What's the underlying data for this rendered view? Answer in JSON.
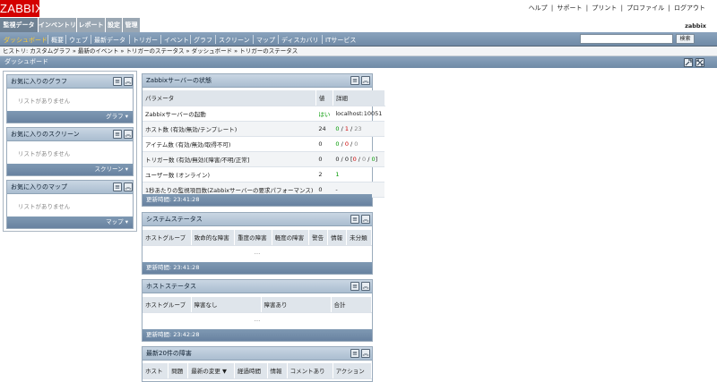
{
  "brand": {
    "logo": "ZABBIX",
    "accent": "#d40000"
  },
  "top_links": [
    "ヘルプ",
    "サポート",
    "プリント",
    "プロファイル",
    "ログアウト"
  ],
  "top_sep": "|",
  "main_menu": [
    "監視データ",
    "インベントリ",
    "レポート",
    "設定",
    "管理"
  ],
  "user": "zabbix",
  "sub_menu": [
    "ダッシュボード",
    "概要",
    "ウェブ",
    "最新データ",
    "トリガー",
    "イベント",
    "グラフ",
    "スクリーン",
    "マップ",
    "ディスカバリ",
    "ITサービス"
  ],
  "search": {
    "value": "",
    "button": "検索"
  },
  "history": "ヒストリ: カスタムグラフ » 最新のイベント » トリガーのステータス » ダッシュボード » トリガーのステータス",
  "page_title": "ダッシュボード",
  "favorites": [
    {
      "title": "お気に入りのグラフ",
      "empty": "リストがありません",
      "footer": "グラフ ▾"
    },
    {
      "title": "お気に入りのスクリーン",
      "empty": "リストがありません",
      "footer": "スクリーン ▾"
    },
    {
      "title": "お気に入りのマップ",
      "empty": "リストがありません",
      "footer": "マップ ▾"
    }
  ],
  "server_status": {
    "title": "Zabbixサーバーの状態",
    "headers": [
      "パラメータ",
      "値",
      "詳細"
    ],
    "rows": [
      {
        "param": "Zabbixサーバーの起動",
        "value": "はい",
        "detail": "localhost:10051"
      },
      {
        "param": "ホスト数 (有効/無効/テンプレート)",
        "value": "24",
        "detail_parts": [
          "0",
          " / ",
          "1",
          " / ",
          "23"
        ]
      },
      {
        "param": "アイテム数 (有効/無効/取得不可)",
        "value": "0",
        "detail_parts": [
          "0",
          " / ",
          "0",
          " / ",
          "0"
        ]
      },
      {
        "param": "トリガー数 (有効/無効)[障害/不明/正常]",
        "value": "0",
        "detail_parts": [
          "0 / 0 [",
          "0",
          " / ",
          "0",
          " / ",
          "0",
          "]"
        ]
      },
      {
        "param": "ユーザー数 (オンライン)",
        "value": "2",
        "detail": "1"
      },
      {
        "param": "1秒あたりの監視項目数(Zabbixサーバーの要求パフォーマンス)",
        "value": "0",
        "detail": "-"
      }
    ],
    "footer": "更新時間: 23:41:28"
  },
  "system_status": {
    "title": "システムステータス",
    "headers": [
      "ホストグループ",
      "致命的な障害",
      "重度の障害",
      "軽度の障害",
      "警告",
      "情報",
      "未分類"
    ],
    "empty": "...",
    "footer": "更新時間: 23:41:28"
  },
  "host_status": {
    "title": "ホストステータス",
    "headers": [
      "ホストグループ",
      "障害なし",
      "障害あり",
      "合計"
    ],
    "empty": "...",
    "footer": "更新時間: 23:42:28"
  },
  "last_issues": {
    "title": "最新20件の障害",
    "headers": [
      "ホスト",
      "問題",
      "最新の変更 ▼",
      "経過時間",
      "情報",
      "コメントあり",
      "アクション"
    ]
  }
}
